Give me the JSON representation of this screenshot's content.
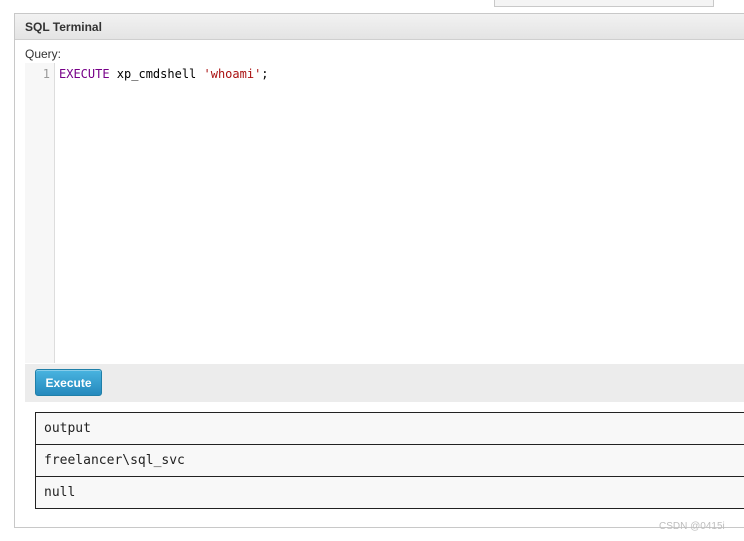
{
  "panel": {
    "title": "SQL Terminal",
    "query_label": "Query:"
  },
  "editor": {
    "line_number": "1",
    "keyword": "EXECUTE",
    "command": " xp_cmdshell ",
    "string_literal": "'whoami'",
    "terminator": ";"
  },
  "actions": {
    "execute_label": "Execute"
  },
  "results": {
    "rows": [
      "output",
      "freelancer\\sql_svc",
      "null"
    ]
  },
  "watermark": "CSDN @0415i",
  "colors": {
    "button": "#2a90c4",
    "keyword": "#770088",
    "string": "#aa1111"
  }
}
